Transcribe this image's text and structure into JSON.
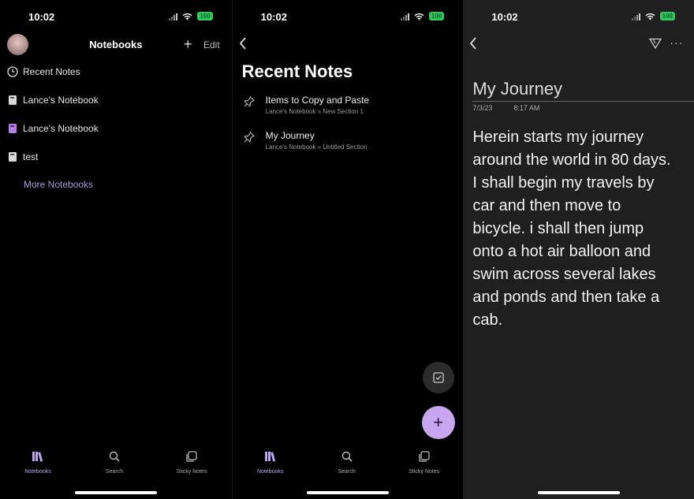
{
  "status": {
    "time": "10:02",
    "battery": "100"
  },
  "notebooks_screen": {
    "title": "Notebooks",
    "edit_label": "Edit",
    "items": [
      {
        "label": "Recent Notes",
        "icon": "clock-icon"
      },
      {
        "label": "Lance's Notebook",
        "icon": "notebook-icon",
        "color": "#d8d8d8"
      },
      {
        "label": "Lance's Notebook",
        "icon": "notebook-icon",
        "color": "#b77ee6"
      },
      {
        "label": "test",
        "icon": "notebook-icon",
        "color": "#d8d8d8"
      }
    ],
    "more_label": "More Notebooks"
  },
  "tabs": [
    {
      "label": "Notebooks",
      "icon": "books-icon"
    },
    {
      "label": "Search",
      "icon": "search-icon"
    },
    {
      "label": "Sticky Notes",
      "icon": "sticky-notes-icon"
    }
  ],
  "recent_screen": {
    "title": "Recent Notes",
    "notes": [
      {
        "title": "Items to Copy and Paste",
        "path": "Lance's Notebook » New Section 1"
      },
      {
        "title": "My Journey",
        "path": "Lance's Notebook » Untitled Section"
      }
    ]
  },
  "note_screen": {
    "title": "My Journey",
    "date": "7/3/23",
    "time": "8:17 AM",
    "body": "Herein starts my journey around the world in 80 days. I shall begin my travels by car and then move to bicycle. i shall then jump onto a hot air balloon and swim across several lakes and ponds and then take a cab."
  },
  "colors": {
    "accent": "#b9a8f0",
    "fab": "#c8a6f0",
    "battery": "#34c759"
  }
}
